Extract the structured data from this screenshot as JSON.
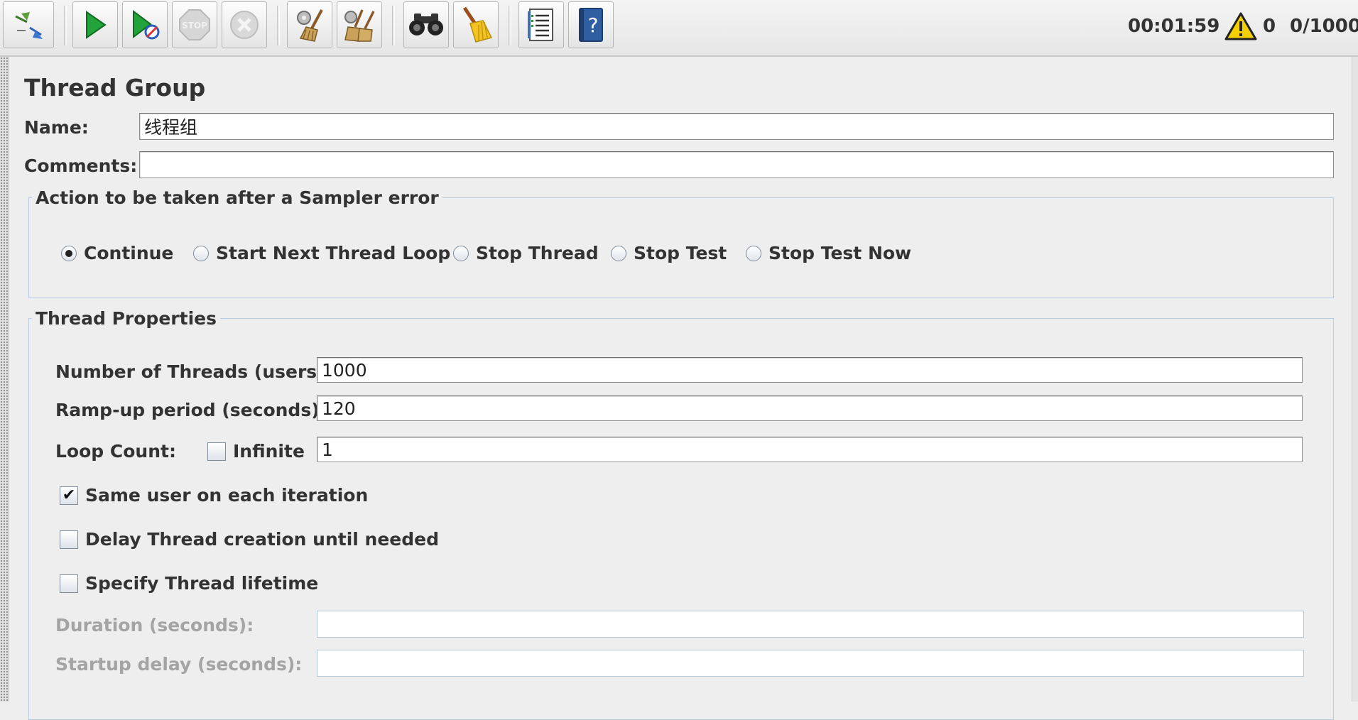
{
  "toolbar": {
    "buttons": [
      {
        "name": "toggle-tree",
        "icon": "expand-collapse-icon"
      },
      {
        "name": "start",
        "icon": "play-icon"
      },
      {
        "name": "start-no-timers",
        "icon": "play-no-pause-icon"
      },
      {
        "name": "stop",
        "icon": "stop-icon"
      },
      {
        "name": "shutdown",
        "icon": "shutdown-icon"
      },
      {
        "name": "clear",
        "icon": "broom-gear-icon"
      },
      {
        "name": "clear-all",
        "icon": "broom-double-icon"
      },
      {
        "name": "search",
        "icon": "binoculars-icon"
      },
      {
        "name": "reset-search",
        "icon": "broom-icon"
      },
      {
        "name": "function-helper",
        "icon": "list-icon"
      },
      {
        "name": "help",
        "icon": "help-book-icon"
      }
    ]
  },
  "status": {
    "elapsed_time": "00:01:59",
    "warning_count": "0",
    "active_threads": "0/1000",
    "accent_warning": "#f5d000"
  },
  "panel": {
    "title": "Thread Group",
    "name_label": "Name:",
    "name_value": "线程组",
    "comments_label": "Comments:",
    "comments_value": ""
  },
  "sampler_error": {
    "legend": "Action to be taken after a Sampler error",
    "options": [
      {
        "label": "Continue",
        "selected": true
      },
      {
        "label": "Start Next Thread Loop",
        "selected": false
      },
      {
        "label": "Stop Thread",
        "selected": false
      },
      {
        "label": "Stop Test",
        "selected": false
      },
      {
        "label": "Stop Test Now",
        "selected": false
      }
    ]
  },
  "thread_properties": {
    "legend": "Thread Properties",
    "num_threads_label": "Number of Threads (users):",
    "num_threads_value": "1000",
    "ramp_up_label": "Ramp-up period (seconds):",
    "ramp_up_value": "120",
    "loop_count_label": "Loop Count:",
    "infinite_label": "Infinite",
    "infinite_checked": false,
    "loop_count_value": "1",
    "same_user_label": "Same user on each iteration",
    "same_user_checked": true,
    "delay_creation_label": "Delay Thread creation until needed",
    "delay_creation_checked": false,
    "specify_lifetime_label": "Specify Thread lifetime",
    "specify_lifetime_checked": false,
    "duration_label": "Duration (seconds):",
    "duration_value": "",
    "startup_delay_label": "Startup delay (seconds):",
    "startup_delay_value": ""
  }
}
